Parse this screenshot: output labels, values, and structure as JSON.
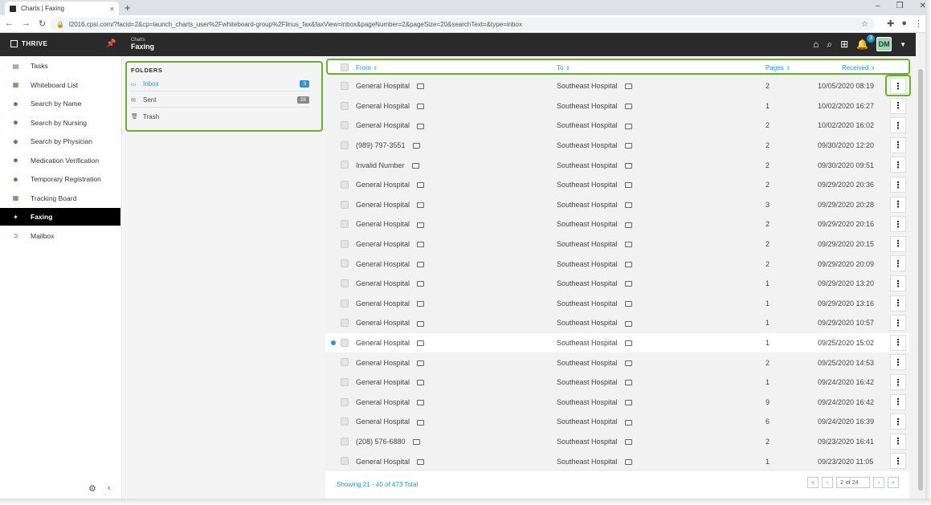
{
  "browser": {
    "tab_title": "Charts | Faxing",
    "tab_close": "×",
    "new_tab": "+",
    "url": "l2016.cpsi.com/?facid=2&cp=launch_charts_user%2Fwhiteboard-group%2Flinus_fax&faxView=inbox&pageNumber=2&pageSize=20&searchText=&type=inbox"
  },
  "header": {
    "brand": "THRIVE",
    "crumb_small": "Charts",
    "crumb_title": "Faxing",
    "notifications": "3",
    "avatar": "DM"
  },
  "sidebar": {
    "items": [
      {
        "label": "Tasks",
        "icon": "tasks-icon"
      },
      {
        "label": "Whiteboard List",
        "icon": "whiteboard-icon"
      },
      {
        "label": "Search by Name",
        "icon": "person-search-icon"
      },
      {
        "label": "Search by Nursing",
        "icon": "nurse-icon"
      },
      {
        "label": "Search by Physician",
        "icon": "physician-icon"
      },
      {
        "label": "Medication Verification",
        "icon": "medication-icon"
      },
      {
        "label": "Temporary Registration",
        "icon": "registration-icon"
      },
      {
        "label": "Tracking Board",
        "icon": "tracking-board-icon"
      },
      {
        "label": "Faxing",
        "icon": "fax-icon"
      },
      {
        "label": "Mailbox",
        "icon": "mailbox-icon"
      }
    ]
  },
  "folders": {
    "title": "FOLDERS",
    "items": [
      {
        "label": "Inbox",
        "count": "3"
      },
      {
        "label": "Sent",
        "count": "28"
      },
      {
        "label": "Trash",
        "count": ""
      }
    ]
  },
  "grid": {
    "columns": {
      "from": "From",
      "to": "To",
      "pages": "Pages",
      "received": "Received"
    },
    "rows": [
      {
        "from": "General Hospital",
        "to": "Southeast Hospital",
        "pages": "2",
        "received": "10/05/2020 08:19"
      },
      {
        "from": "General Hospital",
        "to": "Southeast Hospital",
        "pages": "1",
        "received": "10/02/2020 16:27"
      },
      {
        "from": "General Hospital",
        "to": "Southeast Hospital",
        "pages": "2",
        "received": "10/02/2020 16:02"
      },
      {
        "from": "(989) 797-3551",
        "to": "Southeast Hospital",
        "pages": "2",
        "received": "09/30/2020 12:20"
      },
      {
        "from": "Invalid Number",
        "to": "Southeast Hospital",
        "pages": "2",
        "received": "09/30/2020 09:51"
      },
      {
        "from": "General Hospital",
        "to": "Southeast Hospital",
        "pages": "2",
        "received": "09/29/2020 20:36"
      },
      {
        "from": "General Hospital",
        "to": "Southeast Hospital",
        "pages": "3",
        "received": "09/29/2020 20:28"
      },
      {
        "from": "General Hospital",
        "to": "Southeast Hospital",
        "pages": "2",
        "received": "09/29/2020 20:16"
      },
      {
        "from": "General Hospital",
        "to": "Southeast Hospital",
        "pages": "2",
        "received": "09/29/2020 20:15"
      },
      {
        "from": "General Hospital",
        "to": "Southeast Hospital",
        "pages": "2",
        "received": "09/29/2020 20:09"
      },
      {
        "from": "General Hospital",
        "to": "Southeast Hospital",
        "pages": "1",
        "received": "09/29/2020 13:20"
      },
      {
        "from": "General Hospital",
        "to": "Southeast Hospital",
        "pages": "1",
        "received": "09/29/2020 13:16"
      },
      {
        "from": "General Hospital",
        "to": "Southeast Hospital",
        "pages": "1",
        "received": "09/29/2020 10:57"
      },
      {
        "from": "General Hospital",
        "to": "Southeast Hospital",
        "pages": "1",
        "received": "09/25/2020 15:02"
      },
      {
        "from": "General Hospital",
        "to": "Southeast Hospital",
        "pages": "2",
        "received": "09/25/2020 14:53"
      },
      {
        "from": "General Hospital",
        "to": "Southeast Hospital",
        "pages": "1",
        "received": "09/24/2020 16:42"
      },
      {
        "from": "General Hospital",
        "to": "Southeast Hospital",
        "pages": "9",
        "received": "09/24/2020 16:42"
      },
      {
        "from": "General Hospital",
        "to": "Southeast Hospital",
        "pages": "6",
        "received": "09/24/2020 16:39"
      },
      {
        "from": "(208) 576-6880",
        "to": "Southeast Hospital",
        "pages": "2",
        "received": "09/23/2020 16:41"
      },
      {
        "from": "General Hospital",
        "to": "Southeast Hospital",
        "pages": "1",
        "received": "09/23/2020 11:05"
      }
    ],
    "showing": "Showing 21 - 40 of 473 Total",
    "page_number": "2",
    "page_total": "of 24",
    "pager_first": "«",
    "pager_prev": "‹",
    "pager_next": "›",
    "pager_last": "»"
  },
  "colors": {
    "accent": "#1a9ad6",
    "highlight": "#6aae2e",
    "header": "#2a2a2a"
  }
}
